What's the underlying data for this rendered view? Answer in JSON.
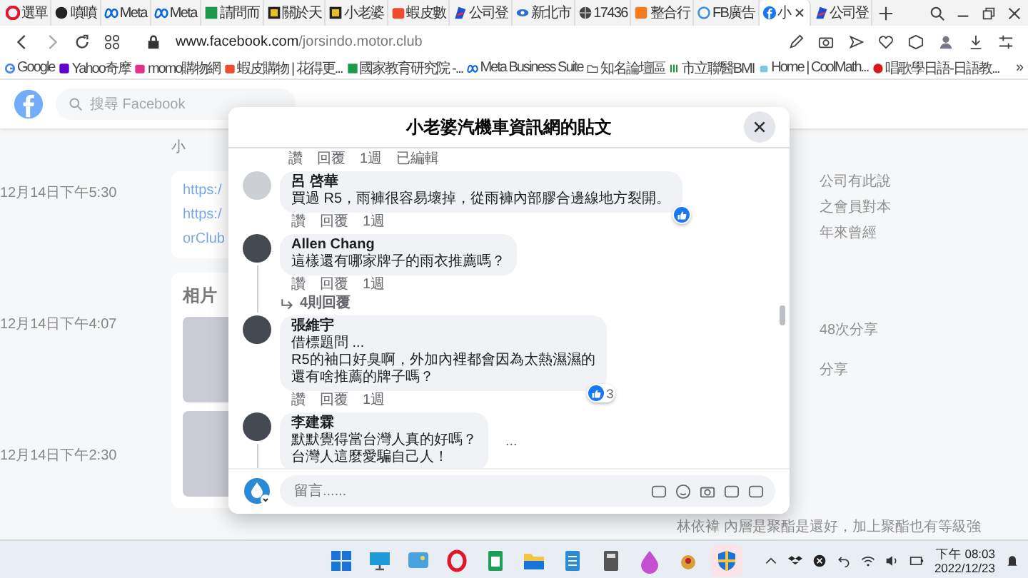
{
  "browser": {
    "tabs": [
      {
        "label": "選單",
        "kind": "opera",
        "selected": false
      },
      {
        "label": "噴噴",
        "kind": "dark",
        "selected": false
      },
      {
        "label": "Meta",
        "kind": "meta",
        "selected": false
      },
      {
        "label": "Meta",
        "kind": "meta",
        "selected": false
      },
      {
        "label": "請問而",
        "kind": "green",
        "selected": false
      },
      {
        "label": "關於天",
        "kind": "yellow",
        "selected": false
      },
      {
        "label": "小老婆",
        "kind": "yellow",
        "selected": false
      },
      {
        "label": "蝦皮數",
        "kind": "shopee",
        "selected": false
      },
      {
        "label": "公司登",
        "kind": "flag",
        "selected": false
      },
      {
        "label": "新北市",
        "kind": "eye",
        "selected": false
      },
      {
        "label": "17436",
        "kind": "globe",
        "selected": false
      },
      {
        "label": "整合行",
        "kind": "orange",
        "selected": false
      },
      {
        "label": "FB廣告",
        "kind": "ring",
        "selected": false
      },
      {
        "label": "小",
        "kind": "facebook",
        "selected": true
      },
      {
        "label": "公司登",
        "kind": "flag",
        "selected": false
      }
    ],
    "url_host": "www.facebook.com",
    "url_path": "/jorsindo.motor.club",
    "bookmarks": [
      {
        "label": "Google",
        "kind": "google"
      },
      {
        "label": "Yahoo奇摩",
        "kind": "yahoo"
      },
      {
        "label": "momo購物網",
        "kind": "momo"
      },
      {
        "label": "蝦皮購物 | 花得更...",
        "kind": "shopee"
      },
      {
        "label": "國家教育研究院 -...",
        "kind": "green"
      },
      {
        "label": "Meta Business Suite",
        "kind": "meta"
      },
      {
        "label": "知名論壇區",
        "kind": "folder"
      },
      {
        "label": "市立聯醫BMI",
        "kind": "bmi"
      },
      {
        "label": "Home | CoolMath...",
        "kind": "robot"
      },
      {
        "label": "唱歌學日語-日語教...",
        "kind": "red"
      }
    ],
    "bookmarks_more": "»"
  },
  "facebook": {
    "search_placeholder": "搜尋 Facebook",
    "page_name": "小",
    "timestamps": [
      "12月14日下午5:30",
      "12月14日下午4:07",
      "12月14日下午2:30"
    ],
    "links": [
      "https:/",
      "https:/",
      "orClub"
    ],
    "photos_title": "相片",
    "side_texts": [
      "公司有此說",
      "之會員對本",
      "年來曾經"
    ],
    "share_count": "48次分享",
    "share_label": "分享",
    "bottom_comment": "林依褘 內層是聚酯是還好，加上聚酯也有等級強"
  },
  "dialog": {
    "title": "小老婆汽機車資訊網的貼文",
    "top_actions": [
      "讚",
      "回覆",
      "1週",
      "已編輯"
    ],
    "comments": [
      {
        "author": "呂 啓華",
        "kind": "default",
        "lines": [
          "買過 R5，雨褲很容易壞掉，從雨褲內部膠合邊線地方裂開。"
        ],
        "reacted": true,
        "actions": [
          "讚",
          "回覆",
          "1週"
        ],
        "thread": false
      },
      {
        "author": "Allen Chang",
        "kind": "photo",
        "lines": [
          "這樣還有哪家牌子的雨衣推薦嗎？"
        ],
        "reacted": false,
        "actions": [
          "讚",
          "回覆",
          "1週"
        ],
        "replies": "4則回覆",
        "thread": true
      },
      {
        "author": "張維宇",
        "kind": "photo",
        "lines": [
          "借標題問 ...",
          "R5的袖口好臭啊，外加內裡都會因為太熱濕濕的",
          "還有啥推薦的牌子嗎？"
        ],
        "reacted": true,
        "reaction_count": "3",
        "actions": [
          "讚",
          "回覆",
          "1週"
        ],
        "thread": false
      },
      {
        "author": "李建霖",
        "kind": "photo",
        "lines": [
          "默默覺得當台灣人真的好嗎？",
          "台灣人這麼愛騙自己人！"
        ],
        "reacted": false,
        "thread": true,
        "more": "..."
      }
    ],
    "composer_placeholder": "留言......"
  },
  "taskbar": {
    "apps": [
      {
        "kind": "start",
        "selected": false
      },
      {
        "kind": "desktop",
        "selected": false
      },
      {
        "kind": "photos",
        "selected": false
      },
      {
        "kind": "opera",
        "selected": false
      },
      {
        "kind": "sheet",
        "selected": false
      },
      {
        "kind": "folder",
        "selected": false
      },
      {
        "kind": "notepad",
        "selected": false
      },
      {
        "kind": "calculator",
        "selected": false
      },
      {
        "kind": "drop",
        "selected": false
      },
      {
        "kind": "bird",
        "selected": false
      },
      {
        "kind": "shield",
        "selected": true
      }
    ],
    "time": "下午 08:03",
    "date": "2022/12/23"
  }
}
